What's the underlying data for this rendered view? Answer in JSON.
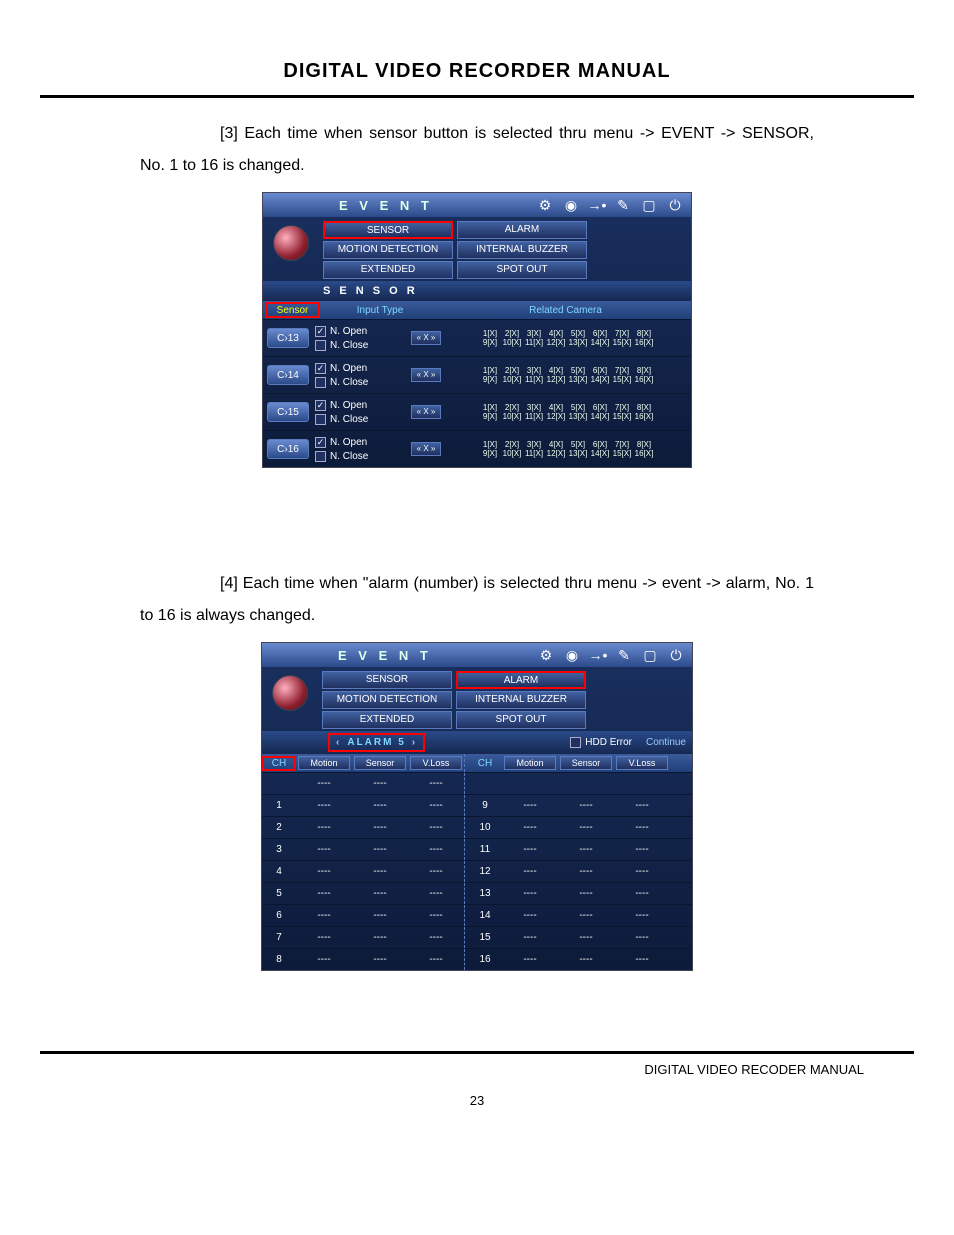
{
  "doc": {
    "main_title": "DIGITAL VIDEO RECORDER MANUAL",
    "footer": "DIGITAL VIDEO RECODER MANUAL",
    "page_number": "23"
  },
  "para3": {
    "prefix": "[3]",
    "text": " Each time when sensor button is selected thru menu -> EVENT -> SENSOR, No. 1 to 16 is changed."
  },
  "para4": {
    "prefix": "[4]",
    "text": " Each time when \"alarm (number) is selected thru menu -> event -> alarm, No. 1 to 16 is always changed."
  },
  "panelA": {
    "header_title": "E V E N T",
    "tabs_left": [
      "SENSOR",
      "MOTION DETECTION",
      "EXTENDED"
    ],
    "tabs_right": [
      "ALARM",
      "INTERNAL BUZZER",
      "SPOT OUT"
    ],
    "section_title": "S E N S O R",
    "head_sensor": "Sensor",
    "head_inputtype": "Input Type",
    "head_relcam": "Related Camera",
    "rows": [
      {
        "label": "C›13",
        "nopen": "N. Open",
        "nclose": "N. Close",
        "btn": "« X »"
      },
      {
        "label": "C›14",
        "nopen": "N. Open",
        "nclose": "N. Close",
        "btn": "« X »"
      },
      {
        "label": "C›15",
        "nopen": "N. Open",
        "nclose": "N. Close",
        "btn": "« X »"
      },
      {
        "label": "C›16",
        "nopen": "N. Open",
        "nclose": "N. Close",
        "btn": "« X »"
      }
    ],
    "cam_labels_top": [
      "1[X]",
      "2[X]",
      "3[X]",
      "4[X]",
      "5[X]",
      "6[X]",
      "7[X]",
      "8[X]"
    ],
    "cam_labels_bot": [
      "9[X]",
      "10[X]",
      "11[X]",
      "12[X]",
      "13[X]",
      "14[X]",
      "15[X]",
      "16[X]"
    ]
  },
  "panelB": {
    "header_title": "E V E N T",
    "tabs_left": [
      "SENSOR",
      "MOTION DETECTION",
      "EXTENDED"
    ],
    "tabs_right": [
      "ALARM",
      "INTERNAL BUZZER",
      "SPOT OUT"
    ],
    "alarm_label": "ALARM 5",
    "hdd_error": "HDD Error",
    "continue": "Continue",
    "col_ch": "CH",
    "cols": [
      "Motion",
      "Sensor",
      "V.Loss"
    ],
    "dash": "----",
    "left_rows": [
      "1",
      "2",
      "3",
      "4",
      "5",
      "6",
      "7",
      "8"
    ],
    "right_rows": [
      "9",
      "10",
      "11",
      "12",
      "13",
      "14",
      "15",
      "16"
    ]
  },
  "icons": {
    "gear": "⚙",
    "eye": "◉",
    "speaker": "→•",
    "pen": "✎",
    "screen": "▢",
    "power": "⏻",
    "left": "‹",
    "right": "›",
    "check": "✓"
  }
}
